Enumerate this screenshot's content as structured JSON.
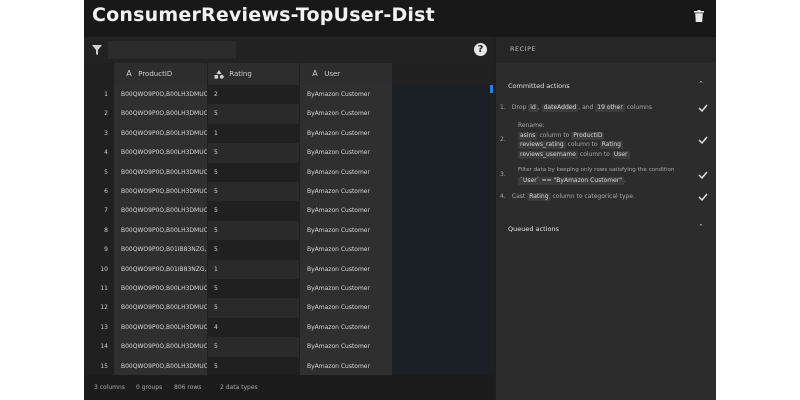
{
  "window": {
    "title": "ConsumerReviews-TopUser-Dist"
  },
  "filter": {
    "placeholder": ""
  },
  "table": {
    "columns": [
      {
        "name": "ProductID",
        "type_icon": "A"
      },
      {
        "name": "Rating",
        "type_icon": "categorical-icon"
      },
      {
        "name": "User",
        "type_icon": "A"
      }
    ],
    "rows": [
      {
        "n": "1",
        "product": "B00QWO9P0O,B00LH3DMUO",
        "rating": "2",
        "user": "ByAmazon Customer"
      },
      {
        "n": "2",
        "product": "B00QWO9P0O,B00LH3DMUO",
        "rating": "5",
        "user": "ByAmazon Customer"
      },
      {
        "n": "3",
        "product": "B00QWO9P0O,B00LH3DMUO",
        "rating": "1",
        "user": "ByAmazon Customer"
      },
      {
        "n": "4",
        "product": "B00QWO9P0O,B00LH3DMUO",
        "rating": "5",
        "user": "ByAmazon Customer"
      },
      {
        "n": "5",
        "product": "B00QWO9P0O,B00LH3DMUO",
        "rating": "5",
        "user": "ByAmazon Customer"
      },
      {
        "n": "6",
        "product": "B00QWO9P0O,B00LH3DMUO",
        "rating": "5",
        "user": "ByAmazon Customer"
      },
      {
        "n": "7",
        "product": "B00QWO9P0O,B00LH3DMUO",
        "rating": "5",
        "user": "ByAmazon Customer"
      },
      {
        "n": "8",
        "product": "B00QWO9P0O,B00LH3DMUO",
        "rating": "5",
        "user": "ByAmazon Customer"
      },
      {
        "n": "9",
        "product": "B00QWO9P0O,B01IB83NZG,...",
        "rating": "5",
        "user": "ByAmazon Customer"
      },
      {
        "n": "10",
        "product": "B00QWO9P0O,B01IB83NZG,...",
        "rating": "1",
        "user": "ByAmazon Customer"
      },
      {
        "n": "11",
        "product": "B00QWO9P0O,B00LH3DMUO",
        "rating": "5",
        "user": "ByAmazon Customer"
      },
      {
        "n": "12",
        "product": "B00QWO9P0O,B00LH3DMUO",
        "rating": "5",
        "user": "ByAmazon Customer"
      },
      {
        "n": "13",
        "product": "B00QWO9P0O,B00LH3DMUO",
        "rating": "4",
        "user": "ByAmazon Customer"
      },
      {
        "n": "14",
        "product": "B00QWO9P0O,B00LH3DMUO",
        "rating": "5",
        "user": "ByAmazon Customer"
      },
      {
        "n": "15",
        "product": "B00QWO9P0O,B00LH3DMUO",
        "rating": "5",
        "user": "ByAmazon Customer"
      }
    ]
  },
  "status": {
    "columns": "3 columns",
    "groups": "0 groups",
    "rows": "806 rows",
    "types": "2 data types"
  },
  "recipe": {
    "tab_label": "RECIPE",
    "committed_header": "Committed actions",
    "queued_header": "Queued actions",
    "step1": {
      "n": "1.",
      "pre": "Drop",
      "chip1": "id",
      "sep": ",",
      "chip2": "dateAdded",
      "mid": ", and",
      "chip3": "19 other",
      "post": "columns"
    },
    "step2": {
      "n": "2.",
      "label": "Rename:",
      "r1_from": "asins",
      "r1_mid": "column to",
      "r1_to": "ProductID",
      "r2_from": "reviews_rating",
      "r2_mid": "column to",
      "r2_to": "Rating",
      "r3_from": "reviews_username",
      "r3_mid": "column to",
      "r3_to": "User"
    },
    "step3": {
      "n": "3.",
      "line1": "Filter data by keeping only rows satisfying the condition",
      "chip": "`User` == \"ByAmazon Customer\"",
      "post": "."
    },
    "step4": {
      "n": "4.",
      "pre": "Cast",
      "chip": "Rating",
      "post": "column to categorical type."
    }
  },
  "colors": {
    "accent": "#2a7fd4",
    "background": "#1f1f1f"
  }
}
